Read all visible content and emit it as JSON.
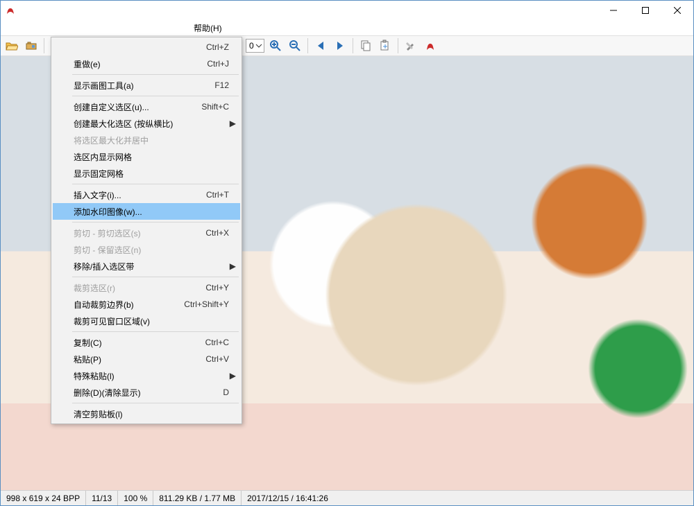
{
  "menubar": {
    "help": "帮助(H)"
  },
  "toolbar": {
    "zoom": "0"
  },
  "menu": {
    "items": [
      {
        "label": "",
        "shortcut": "Ctrl+Z",
        "sep_before": false
      },
      {
        "label": "重做(e)",
        "shortcut": "Ctrl+J"
      },
      {
        "sep": true
      },
      {
        "label": "显示画图工具(a)",
        "shortcut": "F12"
      },
      {
        "sep": true
      },
      {
        "label": "创建自定义选区(u)...",
        "shortcut": "Shift+C"
      },
      {
        "label": "创建最大化选区 (按纵横比)",
        "sub": true
      },
      {
        "label": "将选区最大化并居中",
        "disabled": true
      },
      {
        "label": "选区内显示网格"
      },
      {
        "label": "显示固定网格"
      },
      {
        "sep": true
      },
      {
        "label": "插入文字(i)...",
        "shortcut": "Ctrl+T"
      },
      {
        "label": "添加水印图像(w)...",
        "highlight": true
      },
      {
        "sep": true
      },
      {
        "label": "剪切 - 剪切选区(s)",
        "shortcut": "Ctrl+X",
        "disabled": true
      },
      {
        "label": "剪切 - 保留选区(n)",
        "disabled": true
      },
      {
        "label": "移除/插入选区带",
        "sub": true
      },
      {
        "sep": true
      },
      {
        "label": "裁剪选区(r)",
        "shortcut": "Ctrl+Y",
        "disabled": true
      },
      {
        "label": "自动裁剪边界(b)",
        "shortcut": "Ctrl+Shift+Y"
      },
      {
        "label": "裁剪可见窗口区域(v)"
      },
      {
        "sep": true
      },
      {
        "label": "复制(C)",
        "shortcut": "Ctrl+C"
      },
      {
        "label": "粘贴(P)",
        "shortcut": "Ctrl+V"
      },
      {
        "label": "特殊粘贴(l)",
        "sub": true
      },
      {
        "label": "删除(D)(清除显示)",
        "shortcut": "D"
      },
      {
        "sep": true
      },
      {
        "label": "清空剪贴板(l)"
      }
    ]
  },
  "status": {
    "dims": "998 x 619 x 24 BPP",
    "index": "11/13",
    "zoom": "100 %",
    "size": "811.29 KB / 1.77 MB",
    "datetime": "2017/12/15 / 16:41:26"
  }
}
